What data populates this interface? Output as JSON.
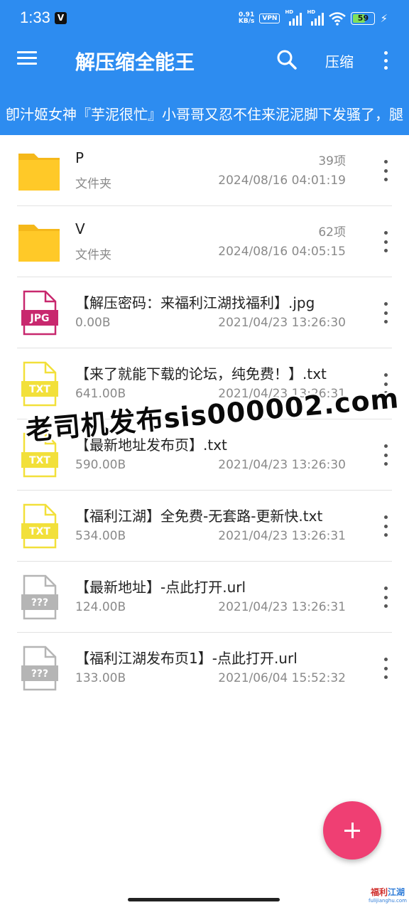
{
  "status_bar": {
    "time": "1:33",
    "app_badge": "V",
    "net_speed_value": "0.91",
    "net_speed_unit": "KB/s",
    "vpn": "VPN",
    "signal1_label": "HD",
    "signal2_label": "HD",
    "battery": "59"
  },
  "app_bar": {
    "title": "解压缩全能王",
    "compress_label": "压缩",
    "icons": [
      "menu-icon",
      "search-icon",
      "more-vert-icon"
    ]
  },
  "marquee_text": "卽汁姬女神『芋泥很忙』小哥哥又忍不住来泥泥脚下发骚了，腿",
  "files": [
    {
      "name": "P",
      "type": "文件夹",
      "count": "39项",
      "date": "2024/08/16 04:01:19",
      "icon": "folder-icon"
    },
    {
      "name": "V",
      "type": "文件夹",
      "count": "62项",
      "date": "2024/08/16 04:05:15",
      "icon": "folder-icon"
    },
    {
      "name": "【解压密码：来福利江湖找福利】.jpg",
      "size": "0.00B",
      "date": "2021/04/23 13:26:30",
      "icon": "jpg-file-icon",
      "icon_label": "JPG"
    },
    {
      "name": "【来了就能下载的论坛，纯免费！】.txt",
      "size": "641.00B",
      "date": "2021/04/23 13:26:31",
      "icon": "txt-file-icon",
      "icon_label": "TXT"
    },
    {
      "name": "【最新地址发布页】.txt",
      "size": "590.00B",
      "date": "2021/04/23 13:26:30",
      "icon": "txt-file-icon",
      "icon_label": "TXT"
    },
    {
      "name": "【福利江湖】全免费-无套路-更新快.txt",
      "size": "534.00B",
      "date": "2021/04/23 13:26:31",
      "icon": "txt-file-icon",
      "icon_label": "TXT"
    },
    {
      "name": "【最新地址】-点此打开.url",
      "size": "124.00B",
      "date": "2021/04/23 13:26:31",
      "icon": "unknown-file-icon",
      "icon_label": "???"
    },
    {
      "name": "【福利江湖发布页1】-点此打开.url",
      "size": "133.00B",
      "date": "2021/06/04 15:52:32",
      "icon": "unknown-file-icon",
      "icon_label": "???"
    }
  ],
  "watermark": "老司机发布sis000002.com",
  "corner_logo": {
    "line1_a": "福利",
    "line1_b": "江湖",
    "line2": "fulijianghu.com"
  },
  "colors": {
    "primary": "#2d8cf0",
    "fab": "#ef3f73",
    "folder": "#ffc928",
    "jpg": "#c8286e",
    "txt": "#f2e03a",
    "unknown": "#b5b5b5"
  }
}
